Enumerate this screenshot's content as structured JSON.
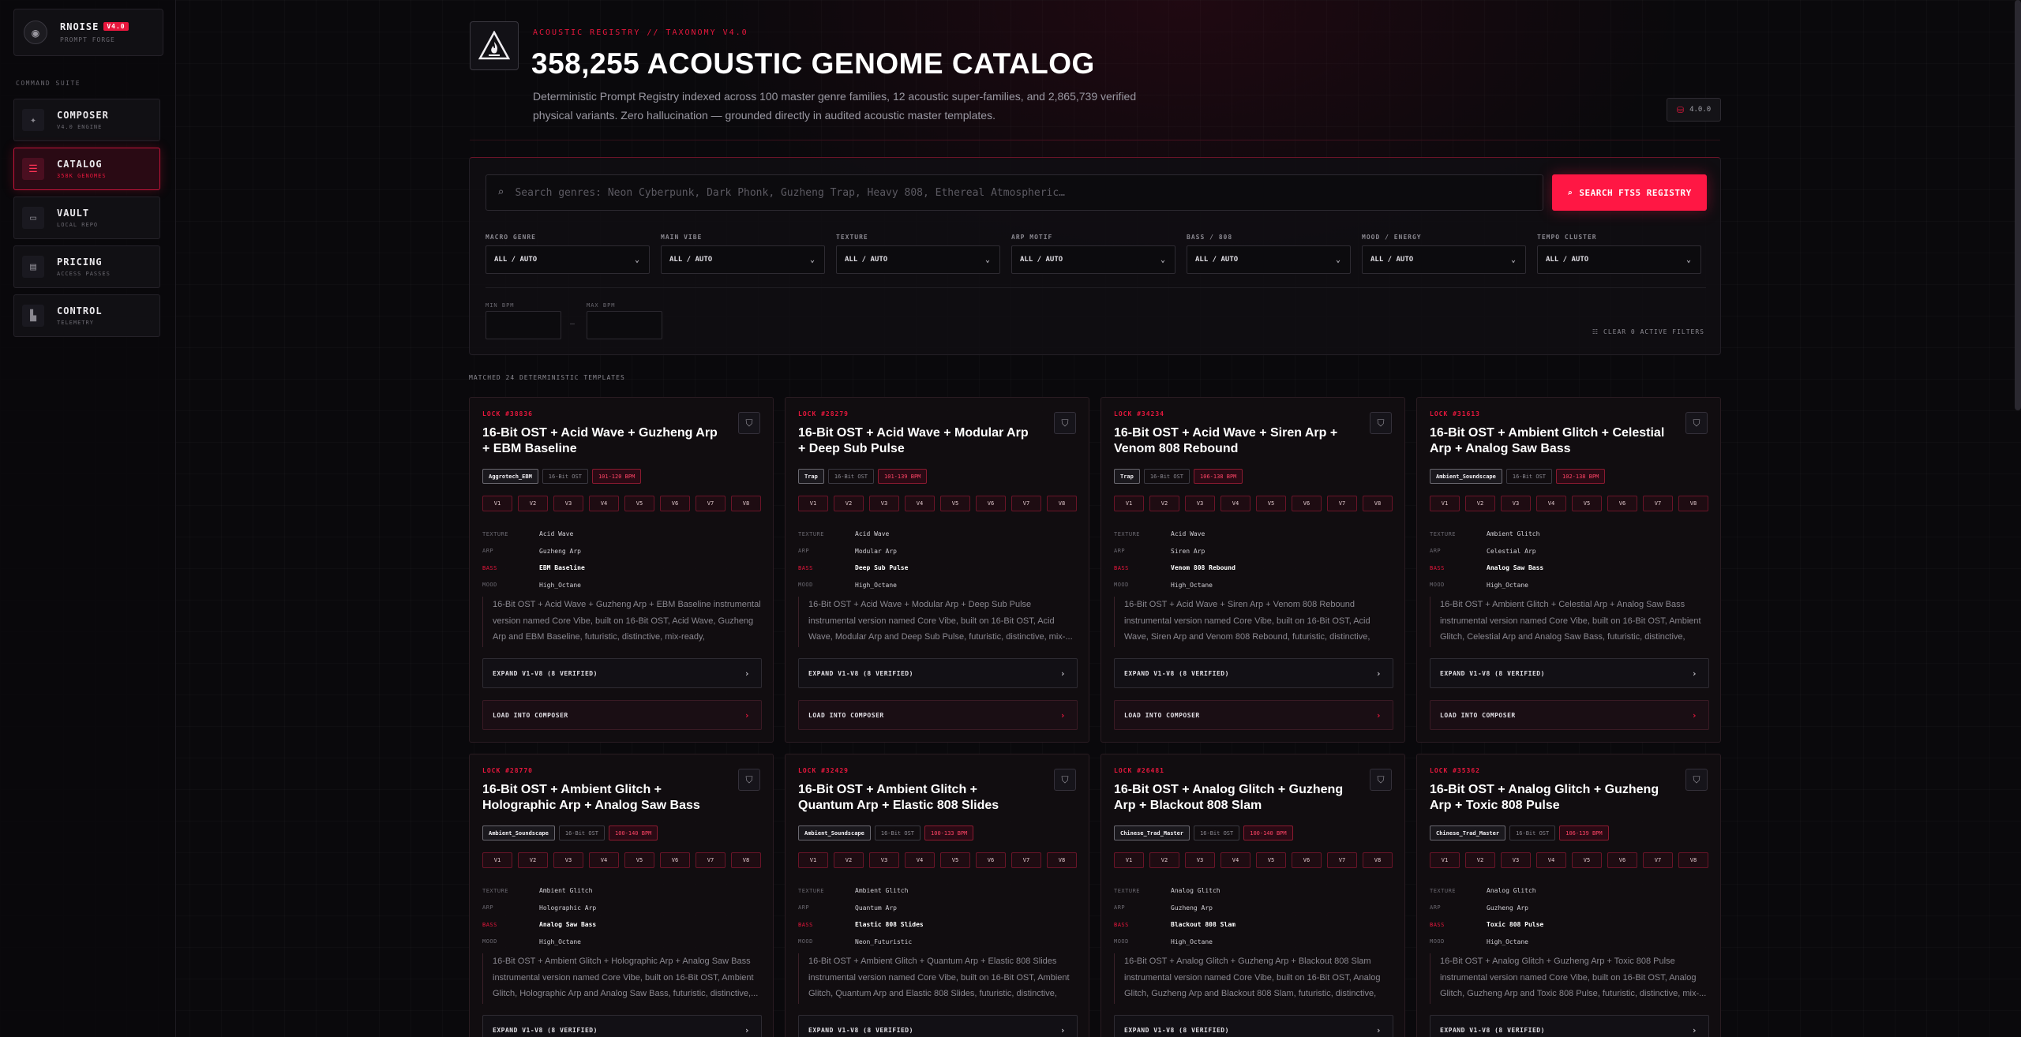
{
  "brand": {
    "name": "RNOISE",
    "version": "V4.0",
    "subtitle": "PROMPT FORGE"
  },
  "sidebar": {
    "section_label": "COMMAND SUITE",
    "items": [
      {
        "title": "COMPOSER",
        "sub": "V4.0 ENGINE",
        "icon": "sparkle-icon"
      },
      {
        "title": "CATALOG",
        "sub": "358K GENOMES",
        "icon": "database-icon",
        "active": true
      },
      {
        "title": "VAULT",
        "sub": "LOCAL REPO",
        "icon": "archive-icon"
      },
      {
        "title": "PRICING",
        "sub": "ACCESS PASSES",
        "icon": "credit-card-icon"
      },
      {
        "title": "CONTROL",
        "sub": "TELEMETRY",
        "icon": "chart-icon"
      }
    ]
  },
  "header": {
    "eyebrow": "ACOUSTIC REGISTRY // TAXONOMY V4.0",
    "title": "358,255 ACOUSTIC GENOME CATALOG",
    "description": "Deterministic Prompt Registry indexed across 100 master genre families, 12 acoustic super-families, and 2,865,739 verified physical variants. Zero hallucination — grounded directly in audited acoustic master templates.",
    "version_badge": "4.0.0"
  },
  "search": {
    "placeholder": "Search genres: Neon Cyberpunk, Dark Phonk, Guzheng Trap, Heavy 808, Ethereal Atmospheric…",
    "button_label": "SEARCH FTS5 REGISTRY"
  },
  "filters": [
    {
      "label": "MACRO GENRE",
      "value": "ALL / AUTO"
    },
    {
      "label": "MAIN VIBE",
      "value": "ALL / AUTO"
    },
    {
      "label": "TEXTURE",
      "value": "ALL / AUTO"
    },
    {
      "label": "ARP MOTIF",
      "value": "ALL / AUTO"
    },
    {
      "label": "BASS / 808",
      "value": "ALL / AUTO"
    },
    {
      "label": "MOOD / ENERGY",
      "value": "ALL / AUTO"
    },
    {
      "label": "TEMPO CLUSTER",
      "value": "ALL / AUTO"
    }
  ],
  "bpm": {
    "min_label": "MIN BPM",
    "max_label": "MAX BPM",
    "min_value": "",
    "max_value": "",
    "separator": "—"
  },
  "clear_filters": "CLEAR 0 ACTIVE FILTERS",
  "matched_text": "MATCHED 24 DETERMINISTIC TEMPLATES",
  "variants": [
    "V1",
    "V2",
    "V3",
    "V4",
    "V5",
    "V6",
    "V7",
    "V8"
  ],
  "attr_labels": {
    "texture": "TEXTURE",
    "arp": "ARP",
    "bass": "BASS",
    "mood": "MOOD"
  },
  "buttons": {
    "expand": "EXPAND V1-V8 (8 VERIFIED)",
    "load": "LOAD INTO COMPOSER"
  },
  "cards": [
    {
      "lock": "LOCK #38836",
      "title": "16-Bit OST + Acid Wave + Guzheng Arp + EBM Baseline",
      "genre": "Aggrotech_EBM",
      "family": "16-Bit OST",
      "bpm": "101-120 BPM",
      "texture": "Acid Wave",
      "arp": "Guzheng Arp",
      "bass": "EBM Baseline",
      "mood": "High_Octane",
      "desc": "16-Bit OST + Acid Wave + Guzheng Arp + EBM Baseline instrumental version named Core Vibe, built on 16-Bit OST, Acid Wave, Guzheng Arp and EBM Baseline, futuristic, distinctive, mix-ready, instrumental,..."
    },
    {
      "lock": "LOCK #28279",
      "title": "16-Bit OST + Acid Wave + Modular Arp + Deep Sub Pulse",
      "genre": "Trap",
      "family": "16-Bit OST",
      "bpm": "101-139 BPM",
      "texture": "Acid Wave",
      "arp": "Modular Arp",
      "bass": "Deep Sub Pulse",
      "mood": "High_Octane",
      "desc": "16-Bit OST + Acid Wave + Modular Arp + Deep Sub Pulse instrumental version named Core Vibe, built on 16-Bit OST, Acid Wave, Modular Arp and Deep Sub Pulse, futuristic, distinctive, mix-..."
    },
    {
      "lock": "LOCK #34234",
      "title": "16-Bit OST + Acid Wave + Siren Arp + Venom 808 Rebound",
      "genre": "Trap",
      "family": "16-Bit OST",
      "bpm": "106-138 BPM",
      "texture": "Acid Wave",
      "arp": "Siren Arp",
      "bass": "Venom 808 Rebound",
      "mood": "High_Octane",
      "desc": "16-Bit OST + Acid Wave + Siren Arp + Venom 808 Rebound instrumental version named Core Vibe, built on 16-Bit OST, Acid Wave, Siren Arp and Venom 808 Rebound, futuristic, distinctive, mix-..."
    },
    {
      "lock": "LOCK #31613",
      "title": "16-Bit OST + Ambient Glitch + Celestial Arp + Analog Saw Bass",
      "genre": "Ambient_Soundscape",
      "family": "16-Bit OST",
      "bpm": "102-138 BPM",
      "texture": "Ambient Glitch",
      "arp": "Celestial Arp",
      "bass": "Analog Saw Bass",
      "mood": "High_Octane",
      "desc": "16-Bit OST + Ambient Glitch + Celestial Arp + Analog Saw Bass instrumental version named Core Vibe, built on 16-Bit OST, Ambient Glitch, Celestial Arp and Analog Saw Bass, futuristic, distinctive, mix-..."
    },
    {
      "lock": "LOCK #28770",
      "title": "16-Bit OST + Ambient Glitch + Holographic Arp + Analog Saw Bass",
      "genre": "Ambient_Soundscape",
      "family": "16-Bit OST",
      "bpm": "100-140 BPM",
      "texture": "Ambient Glitch",
      "arp": "Holographic Arp",
      "bass": "Analog Saw Bass",
      "mood": "High_Octane",
      "desc": "16-Bit OST + Ambient Glitch + Holographic Arp + Analog Saw Bass instrumental version named Core Vibe, built on 16-Bit OST, Ambient Glitch, Holographic Arp and Analog Saw Bass, futuristic, distinctive,..."
    },
    {
      "lock": "LOCK #32429",
      "title": "16-Bit OST + Ambient Glitch + Quantum Arp + Elastic 808 Slides",
      "genre": "Ambient_Soundscape",
      "family": "16-Bit OST",
      "bpm": "100-133 BPM",
      "texture": "Ambient Glitch",
      "arp": "Quantum Arp",
      "bass": "Elastic 808 Slides",
      "mood": "Neon_Futuristic",
      "desc": "16-Bit OST + Ambient Glitch + Quantum Arp + Elastic 808 Slides instrumental version named Core Vibe, built on 16-Bit OST, Ambient Glitch, Quantum Arp and Elastic 808 Slides, futuristic, distinctive, mix-..."
    },
    {
      "lock": "LOCK #26481",
      "title": "16-Bit OST + Analog Glitch + Guzheng Arp + Blackout 808 Slam",
      "genre": "Chinese_Trad_Master",
      "family": "16-Bit OST",
      "bpm": "100-140 BPM",
      "texture": "Analog Glitch",
      "arp": "Guzheng Arp",
      "bass": "Blackout 808 Slam",
      "mood": "High_Octane",
      "desc": "16-Bit OST + Analog Glitch + Guzheng Arp + Blackout 808 Slam instrumental version named Core Vibe, built on 16-Bit OST, Analog Glitch, Guzheng Arp and Blackout 808 Slam, futuristic, distinctive, mi..."
    },
    {
      "lock": "LOCK #35362",
      "title": "16-Bit OST + Analog Glitch + Guzheng Arp + Toxic 808 Pulse",
      "genre": "Chinese_Trad_Master",
      "family": "16-Bit OST",
      "bpm": "106-139 BPM",
      "texture": "Analog Glitch",
      "arp": "Guzheng Arp",
      "bass": "Toxic 808 Pulse",
      "mood": "High_Octane",
      "desc": "16-Bit OST + Analog Glitch + Guzheng Arp + Toxic 808 Pulse instrumental version named Core Vibe, built on 16-Bit OST, Analog Glitch, Guzheng Arp and Toxic 808 Pulse, futuristic, distinctive, mix-..."
    }
  ],
  "colors": {
    "accent": "#ff1744",
    "accent_dark": "#e8173d",
    "background": "#0a090c"
  }
}
